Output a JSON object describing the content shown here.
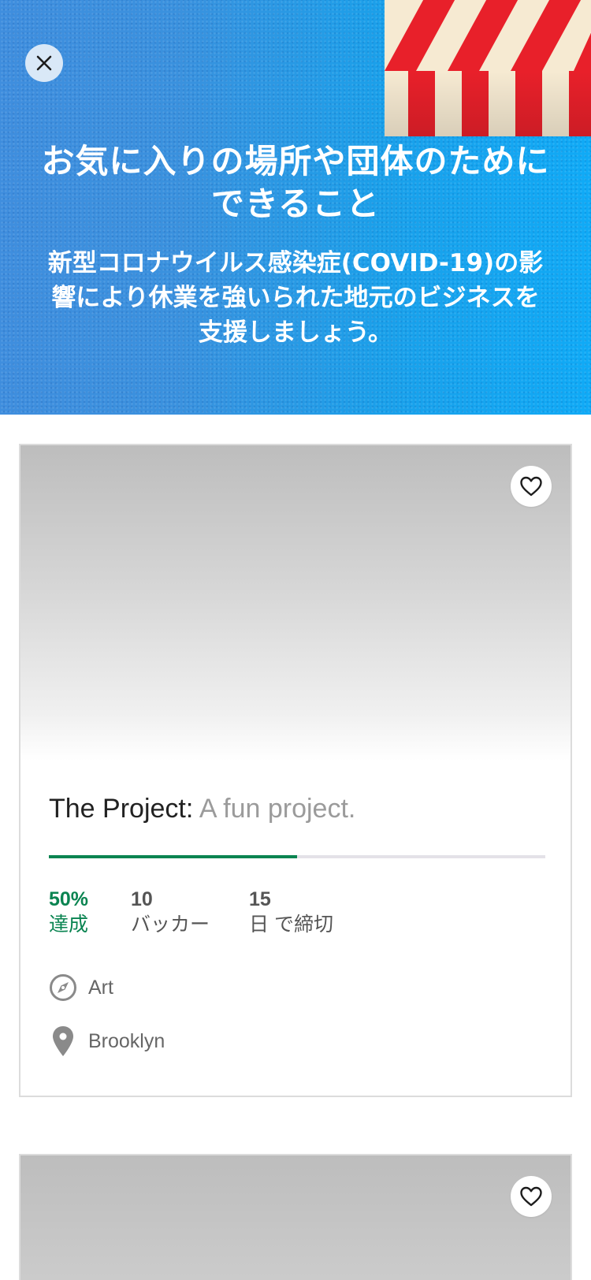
{
  "hero": {
    "title": "お気に入りの場所や団体のためにできること",
    "subtitle": "新型コロナウイルス感染症(COVID-19)の影響により休業を強いられた地元のビジネスを支援しましょう。",
    "close_icon": "close-icon"
  },
  "projects": [
    {
      "name": "The Project:",
      "blurb": "A fun project.",
      "funded_fraction": 0.5,
      "funded_percent": "50%",
      "funded_label": "達成",
      "backers_count": "10",
      "backers_label": "バッカー",
      "days_count": "15",
      "days_label": "日 で締切",
      "category": "Art",
      "location": "Brooklyn"
    }
  ],
  "colors": {
    "accent_green": "#0a8451",
    "hero_blue": "#2a9be6",
    "awning_red": "#e8202a",
    "awning_cream": "#f6ead2"
  },
  "icons": [
    "close-icon",
    "heart-icon",
    "compass-icon",
    "location-pin-icon"
  ]
}
